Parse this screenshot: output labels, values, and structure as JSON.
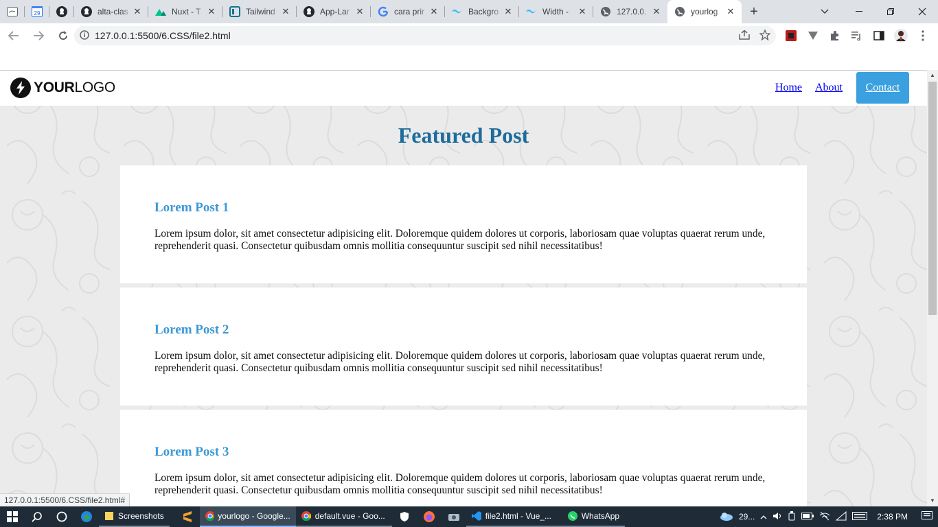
{
  "browser": {
    "tabs": [
      {
        "title": "",
        "icon": "tab-icon"
      },
      {
        "title": "",
        "icon": "calendar-icon",
        "badge": "29"
      },
      {
        "title": "",
        "icon": "github-icon"
      },
      {
        "title": "alta-clas",
        "icon": "github-icon"
      },
      {
        "title": "Nuxt - T",
        "icon": "nuxt-icon"
      },
      {
        "title": "Tailwind",
        "icon": "tailwind-play-icon"
      },
      {
        "title": "App-Lar",
        "icon": "github-icon"
      },
      {
        "title": "cara prir",
        "icon": "google-icon"
      },
      {
        "title": "Backgro",
        "icon": "tailwind-icon"
      },
      {
        "title": "Width -",
        "icon": "tailwind-icon"
      },
      {
        "title": "127.0.0.",
        "icon": "globe-icon"
      },
      {
        "title": "yourlog",
        "icon": "globe-icon",
        "active": true
      }
    ],
    "new_tab": "+",
    "url": "127.0.0.1:5500/6.CSS/file2.html",
    "status_url": "127.0.0.1:5500/6.CSS/file2.html#"
  },
  "site": {
    "logo": {
      "bold": "YOUR",
      "light": "LOGO"
    },
    "nav": {
      "home": "Home",
      "about": "About",
      "contact": "Contact"
    },
    "featured_title": "Featured Post",
    "posts": [
      {
        "title": "Lorem Post 1",
        "body": "Lorem ipsum dolor, sit amet consectetur adipisicing elit. Doloremque quidem dolores ut corporis, laboriosam quae voluptas quaerat rerum unde, reprehenderit quasi. Consectetur quibusdam omnis mollitia consequuntur suscipit sed nihil necessitatibus!"
      },
      {
        "title": "Lorem Post 2",
        "body": "Lorem ipsum dolor, sit amet consectetur adipisicing elit. Doloremque quidem dolores ut corporis, laboriosam quae voluptas quaerat rerum unde, reprehenderit quasi. Consectetur quibusdam omnis mollitia consequuntur suscipit sed nihil necessitatibus!"
      },
      {
        "title": "Lorem Post 3",
        "body": "Lorem ipsum dolor, sit amet consectetur adipisicing elit. Doloremque quidem dolores ut corporis, laboriosam quae voluptas quaerat rerum unde, reprehenderit quasi. Consectetur quibusdam omnis mollitia consequuntur suscipit sed nihil necessitatibus!"
      }
    ],
    "colors": {
      "title": "#1e6c9c",
      "post_title": "#3a98d6",
      "contact_bg": "#3aa0e0"
    }
  },
  "taskbar": {
    "apps": [
      {
        "label": "Screenshots",
        "icon": "folder-icon"
      },
      {
        "label": "yourlogo - Google...",
        "icon": "chrome-icon",
        "active": true
      },
      {
        "label": "default.vue - Goo...",
        "icon": "chrome-icon"
      },
      {
        "label": "file2.html - Vue_...",
        "icon": "vscode-icon"
      },
      {
        "label": "WhatsApp",
        "icon": "whatsapp-icon"
      }
    ],
    "weather": "29...",
    "time": "2:38 PM"
  }
}
